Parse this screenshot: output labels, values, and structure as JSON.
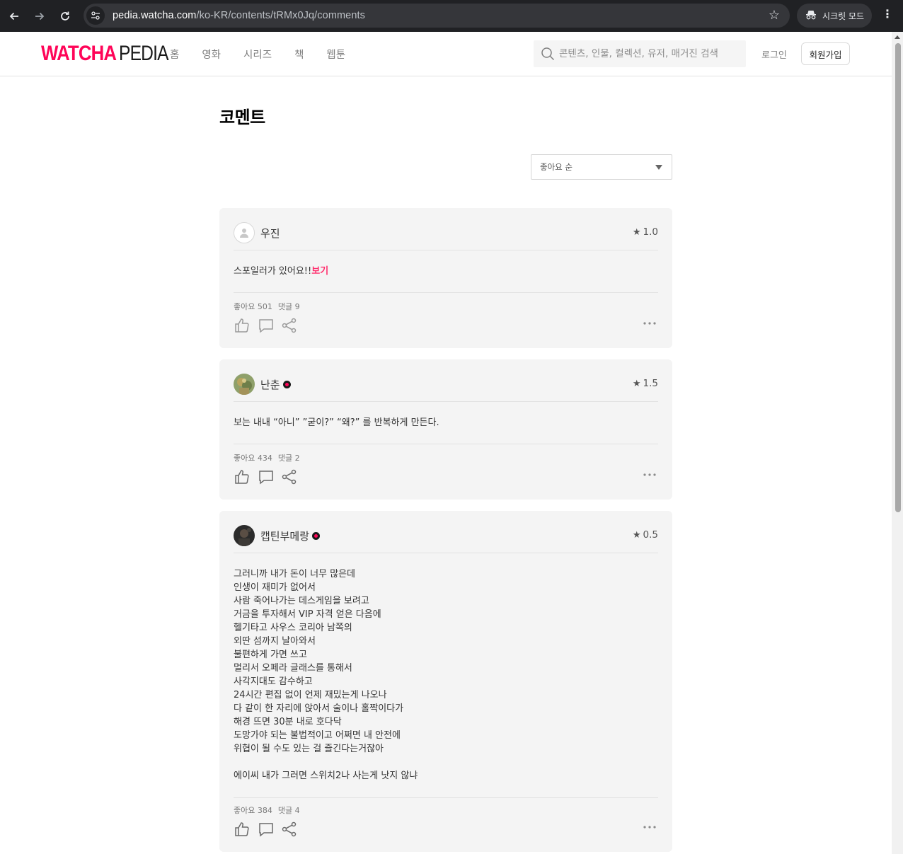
{
  "browser": {
    "url_host": "pedia.watcha.com",
    "url_path": "/ko-KR/contents/tRMx0Jq/comments",
    "incognito_label": "시크릿 모드"
  },
  "site": {
    "logo_brand": "WATCHA",
    "logo_product": "PEDIA",
    "nav": [
      "홈",
      "영화",
      "시리즈",
      "책",
      "웹툰"
    ],
    "search_placeholder": "콘텐츠, 인물, 컬렉션, 유저, 매거진 검색",
    "login": "로그인",
    "signup": "회원가입"
  },
  "page": {
    "title": "코멘트",
    "sort_selected": "좋아요 순"
  },
  "comments": [
    {
      "user": "우진",
      "rating": "1.0",
      "spoiler_text": "스포일러가 있어요!!",
      "spoiler_link": "보기",
      "likes": "좋아요 501",
      "replies": "댓글 9"
    },
    {
      "user": "난춘",
      "rating": "1.5",
      "text": "보는 내내 “아니” ”굳이?” “왜?” 를 반복하게 만든다.",
      "likes": "좋아요 434",
      "replies": "댓글 2"
    },
    {
      "user": "캡틴부메랑",
      "rating": "0.5",
      "lines": [
        "그러니까 내가 돈이 너무 많은데",
        "인생이 재미가 없어서",
        "사람 죽어나가는 데스게임을 보려고",
        "거금을 투자해서 VIP 자격 얻은 다음에",
        "헬기타고 사우스 코리아 남쪽의",
        "외딴 섬까지 날아와서",
        "불편하게 가면 쓰고",
        "멀리서 오페라 글래스를 통해서",
        "사각지대도 감수하고",
        "24시간 편집 없이 언제 재밌는게 나오나",
        "다 같이 한 자리에 앉아서 술이나 홀짝이다가",
        "해경 뜨면 30분 내로 호다닥",
        "도망가야 되는 불법적이고 어쩌면 내 안전에",
        "위협이 될 수도 있는 걸 즐긴다는거잖아",
        "",
        "에이씨 내가 그러면 스위치2나 사는게 낫지 않냐"
      ],
      "likes": "좋아요 384",
      "replies": "댓글 4"
    }
  ]
}
